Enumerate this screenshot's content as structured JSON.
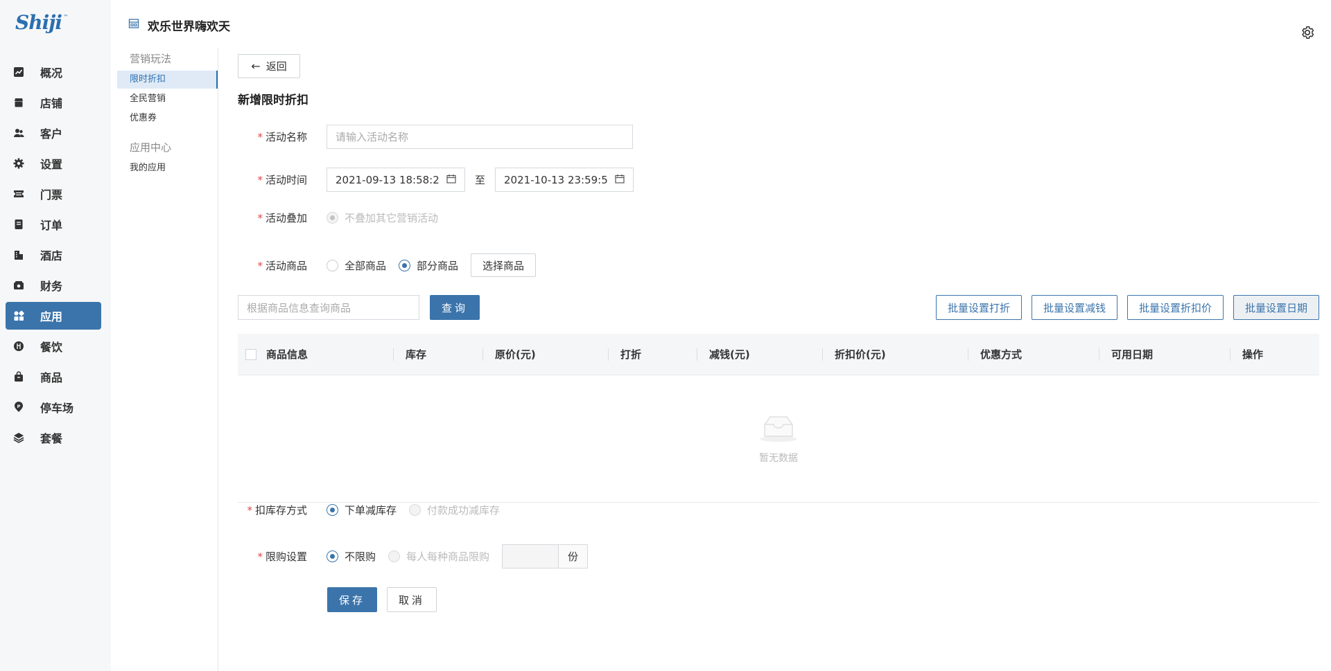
{
  "brand": {
    "logo_text": "Shiji",
    "logo_mark": "™"
  },
  "nav": {
    "items": [
      {
        "label": "概况",
        "icon": "chart-icon"
      },
      {
        "label": "店铺",
        "icon": "store-icon"
      },
      {
        "label": "客户",
        "icon": "users-icon"
      },
      {
        "label": "设置",
        "icon": "gear-icon"
      },
      {
        "label": "门票",
        "icon": "ticket-icon"
      },
      {
        "label": "订单",
        "icon": "order-icon"
      },
      {
        "label": "酒店",
        "icon": "hotel-icon"
      },
      {
        "label": "财务",
        "icon": "finance-icon"
      },
      {
        "label": "应用",
        "icon": "apps-icon",
        "active": true
      },
      {
        "label": "餐饮",
        "icon": "dining-icon"
      },
      {
        "label": "商品",
        "icon": "goods-icon"
      },
      {
        "label": "停车场",
        "icon": "parking-icon"
      },
      {
        "label": "套餐",
        "icon": "layers-icon"
      }
    ]
  },
  "store": {
    "title": "欢乐世界嗨欢天"
  },
  "subnav": {
    "group1": "营销玩法",
    "items1": [
      "限时折扣",
      "全民营销",
      "优惠券"
    ],
    "group2": "应用中心",
    "items2": [
      "我的应用"
    ]
  },
  "back_label": "返回",
  "page_title": "新增限时折扣",
  "form": {
    "name_label": "活动名称",
    "name_placeholder": "请输入活动名称",
    "time_label": "活动时间",
    "time_start": "2021-09-13 18:58:2",
    "time_sep": "至",
    "time_end": "2021-10-13 23:59:5",
    "stack_label": "活动叠加",
    "stack_option": "不叠加其它营销活动",
    "goods_label": "活动商品",
    "goods_all": "全部商品",
    "goods_part": "部分商品",
    "goods_select": "选择商品",
    "stock_label": "扣库存方式",
    "stock_order": "下单减库存",
    "stock_paid": "付款成功减库存",
    "limit_label": "限购设置",
    "limit_none": "不限购",
    "limit_each": "每人每种商品限购",
    "limit_unit": "份"
  },
  "search": {
    "placeholder": "根据商品信息查询商品",
    "query": "查询"
  },
  "batch": [
    "批量设置打折",
    "批量设置减钱",
    "批量设置折扣价",
    "批量设置日期"
  ],
  "table": {
    "columns": [
      "商品信息",
      "库存",
      "原价(元)",
      "打折",
      "减钱(元)",
      "折扣价(元)",
      "优惠方式",
      "可用日期",
      "操作"
    ],
    "empty_text": "暂无数据"
  },
  "actions": {
    "save": "保存",
    "cancel": "取消"
  },
  "colors": {
    "primary": "#3b74ab",
    "required": "#e04646"
  }
}
